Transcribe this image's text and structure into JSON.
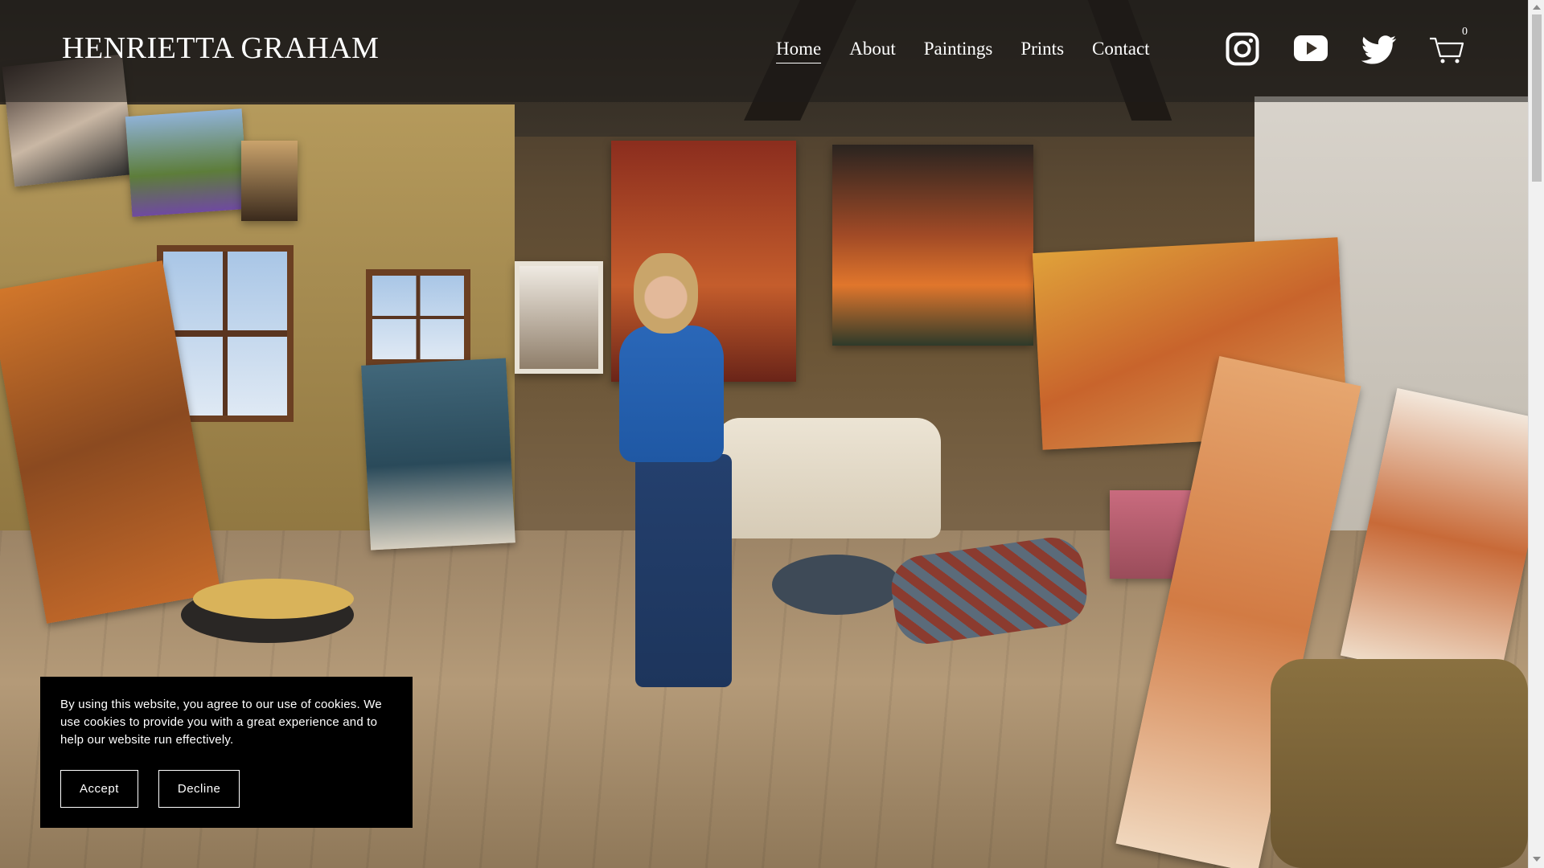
{
  "header": {
    "site_title": "HENRIETTA GRAHAM",
    "nav": [
      {
        "label": "Home",
        "active": true
      },
      {
        "label": "About",
        "active": false
      },
      {
        "label": "Paintings",
        "active": false
      },
      {
        "label": "Prints",
        "active": false
      },
      {
        "label": "Contact",
        "active": false
      }
    ],
    "social_icons": [
      "instagram-icon",
      "youtube-icon",
      "twitter-icon"
    ],
    "cart": {
      "icon": "cart-icon",
      "count": "0"
    }
  },
  "hero": {
    "type": "video-background",
    "scene": "painter-studio"
  },
  "cookie_banner": {
    "text": "By using this website, you agree to our use of cookies. We use cookies to provide you with a great experience and to help our website run effectively.",
    "accept_label": "Accept",
    "decline_label": "Decline"
  },
  "colors": {
    "header_text": "#ffffff",
    "cookie_bg": "#000000",
    "cookie_text": "#ffffff"
  }
}
